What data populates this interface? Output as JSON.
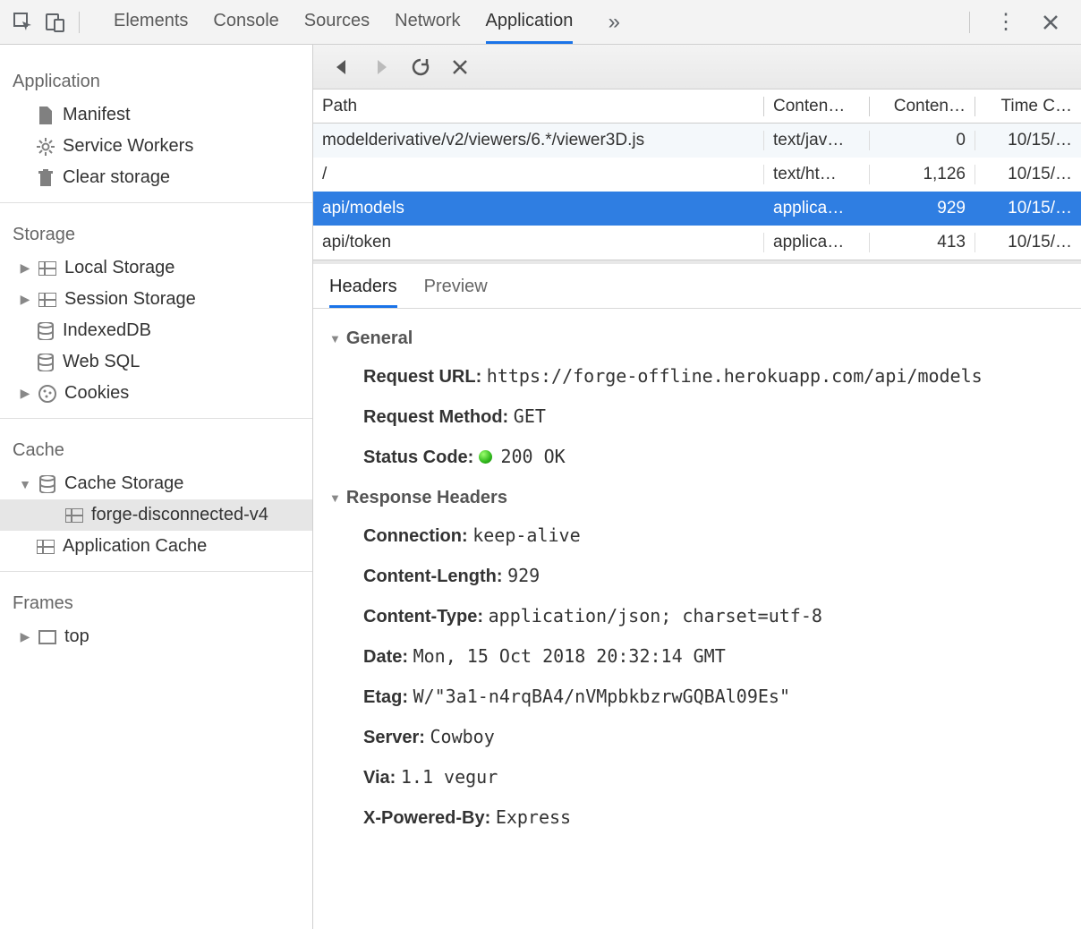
{
  "topTabs": {
    "items": [
      "Elements",
      "Console",
      "Sources",
      "Network",
      "Application"
    ],
    "activeIndex": 4
  },
  "sidebar": {
    "application": {
      "title": "Application",
      "items": [
        {
          "label": "Manifest",
          "icon": "file-icon"
        },
        {
          "label": "Service Workers",
          "icon": "gear-icon"
        },
        {
          "label": "Clear storage",
          "icon": "trash-icon"
        }
      ]
    },
    "storage": {
      "title": "Storage",
      "items": [
        {
          "label": "Local Storage",
          "icon": "grid-icon",
          "expandable": true
        },
        {
          "label": "Session Storage",
          "icon": "grid-icon",
          "expandable": true
        },
        {
          "label": "IndexedDB",
          "icon": "db-icon"
        },
        {
          "label": "Web SQL",
          "icon": "db-icon"
        },
        {
          "label": "Cookies",
          "icon": "cookie-icon",
          "expandable": true
        }
      ]
    },
    "cache": {
      "title": "Cache",
      "cacheStorage": {
        "label": "Cache Storage",
        "expanded": true
      },
      "cacheEntries": [
        {
          "label": "forge-disconnected-v4",
          "selected": true
        }
      ],
      "appCache": {
        "label": "Application Cache"
      }
    },
    "frames": {
      "title": "Frames",
      "items": [
        {
          "label": "top",
          "expandable": true
        }
      ]
    }
  },
  "requestTable": {
    "headers": {
      "path": "Path",
      "contentType": "Conten…",
      "contentLength": "Conten…",
      "timeCached": "Time C…"
    },
    "rows": [
      {
        "path": "modelderivative/v2/viewers/6.*/viewer3D.js",
        "ct": "text/jav…",
        "cl": "0",
        "tc": "10/15/…"
      },
      {
        "path": "/",
        "ct": "text/ht…",
        "cl": "1,126",
        "tc": "10/15/…"
      },
      {
        "path": "api/models",
        "ct": "applica…",
        "cl": "929",
        "tc": "10/15/…",
        "selected": true
      },
      {
        "path": "api/token",
        "ct": "applica…",
        "cl": "413",
        "tc": "10/15/…"
      }
    ]
  },
  "lowerTabs": {
    "items": [
      "Headers",
      "Preview"
    ],
    "activeIndex": 0
  },
  "headersPane": {
    "general": {
      "title": "General",
      "requestUrlLabel": "Request URL:",
      "requestUrl": "https://forge-offline.herokuapp.com/api/models",
      "requestMethodLabel": "Request Method:",
      "requestMethod": "GET",
      "statusCodeLabel": "Status Code:",
      "statusCode": "200 OK"
    },
    "response": {
      "title": "Response Headers",
      "rows": [
        {
          "k": "Connection:",
          "v": "keep-alive"
        },
        {
          "k": "Content-Length:",
          "v": "929"
        },
        {
          "k": "Content-Type:",
          "v": "application/json; charset=utf-8"
        },
        {
          "k": "Date:",
          "v": "Mon, 15 Oct 2018 20:32:14 GMT"
        },
        {
          "k": "Etag:",
          "v": "W/\"3a1-n4rqBA4/nVMpbkbzrwGQBAl09Es\""
        },
        {
          "k": "Server:",
          "v": "Cowboy"
        },
        {
          "k": "Via:",
          "v": "1.1 vegur"
        },
        {
          "k": "X-Powered-By:",
          "v": "Express"
        }
      ]
    }
  }
}
